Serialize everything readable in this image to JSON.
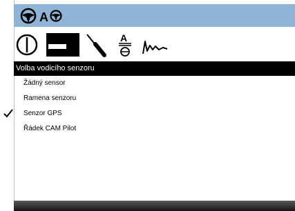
{
  "header": {
    "icons": [
      "steering-wheel-icon",
      "auto-steer-icon"
    ],
    "background": "#8fb4d6"
  },
  "toolbar": {
    "tools": [
      "power-icon",
      "sensor-bar-icon",
      "screwdriver-icon",
      "calibrate-icon",
      "signal-icon"
    ]
  },
  "menu": {
    "title": "Volba vodicího senzoru",
    "items": [
      {
        "label": "Žádný sensor",
        "selected": false
      },
      {
        "label": "Ramena senzoru",
        "selected": false
      },
      {
        "label": "Senzor GPS",
        "selected": true
      },
      {
        "label": "Řádek CAM Pilot",
        "selected": false
      }
    ]
  }
}
